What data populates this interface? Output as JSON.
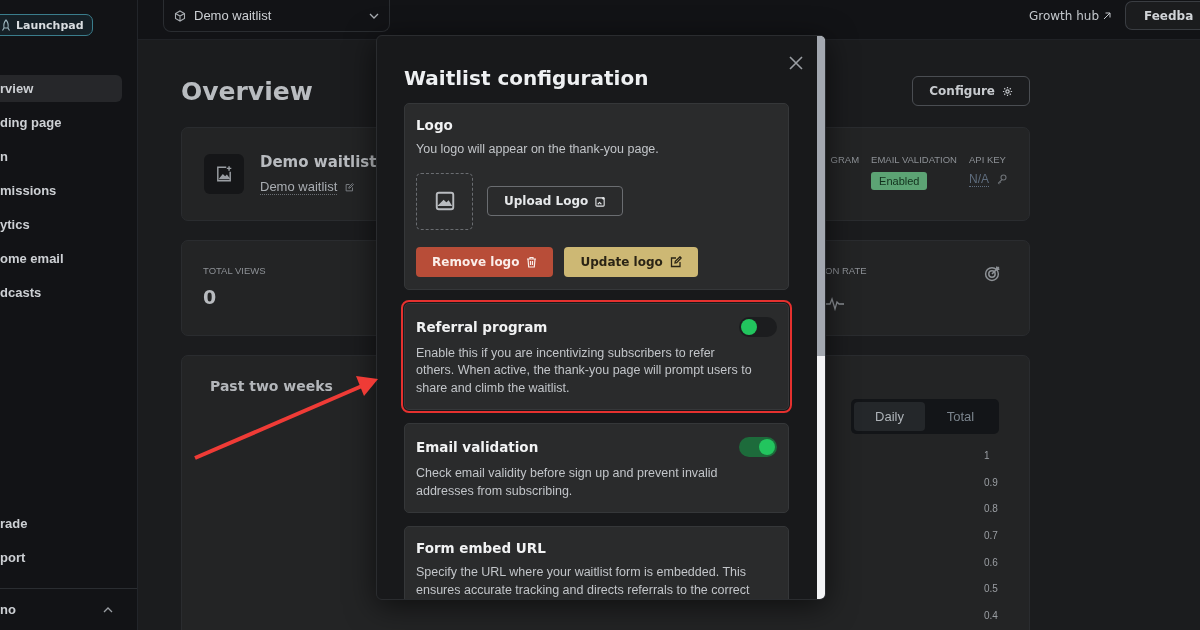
{
  "sidebar": {
    "badge": "Launchpad",
    "items": [
      {
        "label": "rview",
        "selected": true
      },
      {
        "label": "ding page",
        "selected": false
      },
      {
        "label": "n",
        "selected": false
      },
      {
        "label": "missions",
        "selected": false
      },
      {
        "label": "ytics",
        "selected": false
      },
      {
        "label": "ome email",
        "selected": false
      },
      {
        "label": "dcasts",
        "selected": false
      }
    ],
    "footer_items": [
      "rade",
      "port"
    ],
    "account": "no"
  },
  "topbar": {
    "project_select": "Demo waitlist",
    "growth_link": "Growth hub",
    "feedback_button": "Feedba"
  },
  "page": {
    "title": "Overview",
    "configure_button": "Configure",
    "project": {
      "name": "Demo waitlist",
      "link": "Demo waitlist",
      "settings": [
        {
          "label": "GRAM"
        },
        {
          "label": "EMAIL VALIDATION",
          "badge": "Enabled"
        },
        {
          "label": "API KEY",
          "value": "N/A"
        }
      ]
    },
    "stats": [
      {
        "label": "TOTAL VIEWS",
        "value": "0"
      },
      {
        "label": "ON RATE"
      }
    ],
    "chart": {
      "title": "Past two weeks",
      "tabs": [
        {
          "label": "Daily",
          "selected": true
        },
        {
          "label": "Total",
          "selected": false
        }
      ],
      "y_ticks": [
        "1",
        "0.9",
        "0.8",
        "0.7",
        "0.6",
        "0.5",
        "0.4"
      ]
    }
  },
  "modal": {
    "title": "Waitlist configuration",
    "sections": [
      {
        "kind": "logo",
        "title": "Logo",
        "description": "You logo will appear on the thank-you page.",
        "upload_button": "Upload Logo",
        "remove_button": "Remove logo",
        "update_button": "Update logo"
      },
      {
        "kind": "toggle",
        "title": "Referral program",
        "on": false,
        "highlighted": true,
        "description": "Enable this if you are incentivizing subscribers to refer others. When active, the thank-you page will prompt users to share and climb the waitlist."
      },
      {
        "kind": "toggle",
        "title": "Email validation",
        "on": true,
        "highlighted": false,
        "description": "Check email validity before sign up and prevent invalid addresses from subscribing."
      },
      {
        "kind": "text",
        "title": "Form embed URL",
        "description": "Specify the URL where your waitlist form is embedded. This ensures accurate tracking and directs referrals to the correct"
      }
    ]
  }
}
